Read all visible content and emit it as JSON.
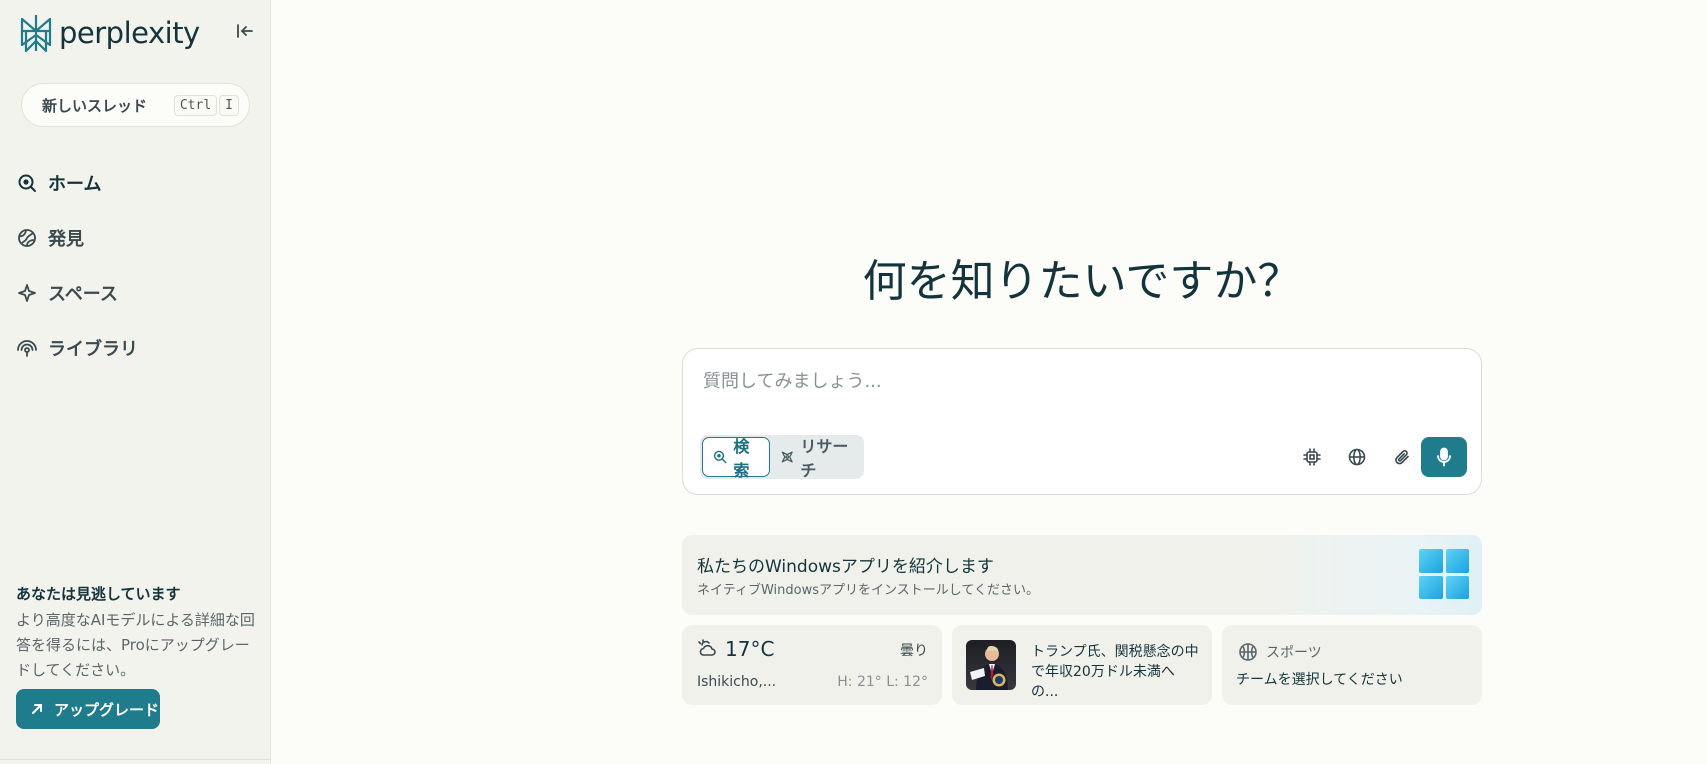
{
  "app": {
    "name": "perplexity",
    "accent_color": "#1f7c8c"
  },
  "sidebar": {
    "new_thread": {
      "label": "新しいスレッド",
      "shortcut": [
        "Ctrl",
        "I"
      ]
    },
    "nav": [
      {
        "label": "ホーム",
        "icon": "search-circle-icon",
        "active": true
      },
      {
        "label": "発見",
        "icon": "globe-icon",
        "active": false
      },
      {
        "label": "スペース",
        "icon": "sparkle-icon",
        "active": false
      },
      {
        "label": "ライブラリ",
        "icon": "library-icon",
        "active": false
      }
    ],
    "upsell": {
      "title": "あなたは見逃しています",
      "body": "より高度なAIモデルによる詳細な回答を得るには、Proにアップグレードしてください。",
      "button_label": "アップグレード"
    }
  },
  "main": {
    "headline": "何を知りたいですか？",
    "composer": {
      "placeholder": "質問してみましょう...",
      "modes": [
        {
          "label": "検索",
          "icon": "search-icon",
          "active": true
        },
        {
          "label": "リサーチ",
          "icon": "research-icon",
          "active": false
        }
      ],
      "tools": [
        "model-chip-icon",
        "globe-icon",
        "paperclip-icon",
        "microphone-icon"
      ]
    },
    "promo": {
      "title": "私たちのWindowsアプリを紹介します",
      "subtitle": "ネイティブWindowsアプリをインストールしてください。"
    },
    "cards": {
      "weather": {
        "temp": "17°C",
        "condition": "曇り",
        "location": "Ishikicho,...",
        "high_low": "H: 21° L: 12°"
      },
      "news": {
        "headline": "トランプ氏、関税懸念の中で年収20万ドル未満への..."
      },
      "sports": {
        "label": "スポーツ",
        "subtitle": "チームを選択してください"
      }
    }
  }
}
